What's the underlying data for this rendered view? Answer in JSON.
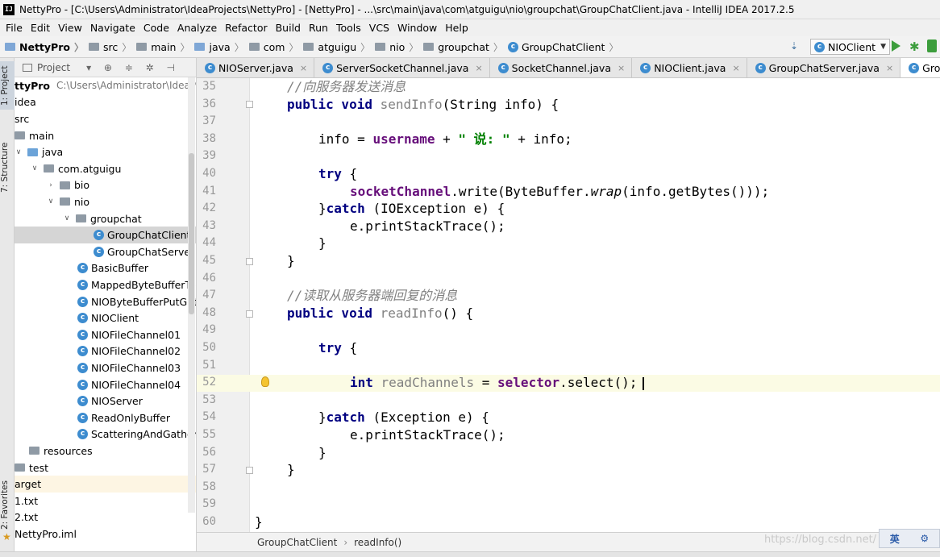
{
  "window": {
    "title": "NettyPro - [C:\\Users\\Administrator\\IdeaProjects\\NettyPro] - [NettyPro] - ...\\src\\main\\java\\com\\atguigu\\nio\\groupchat\\GroupChatClient.java - IntelliJ IDEA 2017.2.5",
    "app_icon": "IJ"
  },
  "menu": [
    "File",
    "Edit",
    "View",
    "Navigate",
    "Code",
    "Analyze",
    "Refactor",
    "Build",
    "Run",
    "Tools",
    "VCS",
    "Window",
    "Help"
  ],
  "navbar": {
    "crumbs": [
      "NettyPro",
      "src",
      "main",
      "java",
      "com",
      "atguigu",
      "nio",
      "groupchat",
      "GroupChatClient"
    ],
    "run_config": "NIOClient"
  },
  "sidebar_tabs": {
    "project": "1: Project",
    "structure": "7: Structure",
    "favorites": "2: Favorites"
  },
  "project_panel": {
    "title": "Project",
    "tree": [
      {
        "label": "ttyPro",
        "path": "C:\\Users\\Administrator\\IdeaProje"
      },
      {
        "label": "idea"
      },
      {
        "label": "src"
      },
      {
        "label": "main"
      },
      {
        "label": "java"
      },
      {
        "label": "com.atguigu"
      },
      {
        "label": "bio"
      },
      {
        "label": "nio"
      },
      {
        "label": "groupchat"
      },
      {
        "label": "GroupChatClient"
      },
      {
        "label": "GroupChatServer"
      },
      {
        "label": "BasicBuffer"
      },
      {
        "label": "MappedByteBufferTest"
      },
      {
        "label": "NIOByteBufferPutGet"
      },
      {
        "label": "NIOClient"
      },
      {
        "label": "NIOFileChannel01"
      },
      {
        "label": "NIOFileChannel02"
      },
      {
        "label": "NIOFileChannel03"
      },
      {
        "label": "NIOFileChannel04"
      },
      {
        "label": "NIOServer"
      },
      {
        "label": "ReadOnlyBuffer"
      },
      {
        "label": "ScatteringAndGathering"
      },
      {
        "label": "resources"
      },
      {
        "label": "test"
      },
      {
        "label": "arget"
      },
      {
        "label": "1.txt"
      },
      {
        "label": "2.txt"
      },
      {
        "label": "NettyPro.iml"
      }
    ]
  },
  "editor": {
    "tabs": [
      "NIOServer.java",
      "ServerSocketChannel.java",
      "SocketChannel.java",
      "NIOClient.java",
      "GroupChatServer.java",
      "GroupChatClient.ja"
    ],
    "line_numbers": [
      "35",
      "36",
      "37",
      "38",
      "39",
      "40",
      "41",
      "42",
      "43",
      "44",
      "45",
      "46",
      "47",
      "48",
      "49",
      "50",
      "51",
      "52",
      "53",
      "54",
      "55",
      "56",
      "57",
      "58",
      "59",
      "60"
    ],
    "code": {
      "l35_comment": "//向服务器发送消息",
      "l36_kw": "public void ",
      "l36_method": "sendInfo",
      "l36_rest": "(String info) {",
      "l38_a": "info = ",
      "l38_field": "username",
      "l38_b": " + ",
      "l38_str": "\" 说: \"",
      "l38_c": " + info;",
      "l40_kw": "try",
      "l40_rest": " {",
      "l41_field": "socketChannel",
      "l41_a": ".write(ByteBuffer.",
      "l41_italic": "wrap",
      "l41_b": "(info.getBytes()));",
      "l42_a": "}",
      "l42_kw": "catch",
      "l42_b": " (IOException e) {",
      "l43": "e.printStackTrace();",
      "l44": "}",
      "l45": "}",
      "l47_comment": "//读取从服务器端回复的消息",
      "l48_kw": "public void ",
      "l48_method": "readInfo",
      "l48_rest": "() {",
      "l50_kw": "try",
      "l50_rest": " {",
      "l52_kw": "int ",
      "l52_var": "readChannels",
      "l52_a": " = ",
      "l52_field": "selector",
      "l52_b": ".select();",
      "l54_a": "}",
      "l54_kw": "catch",
      "l54_b": " (Exception e) {",
      "l55": "e.printStackTrace();",
      "l56": "}",
      "l57": "}",
      "l60": "}"
    },
    "breadcrumb": [
      "GroupChatClient",
      "readInfo()"
    ]
  },
  "watermark": "https://blog.csdn.net/",
  "ime": {
    "mode": "英",
    "extra": "⚙"
  },
  "colors": {
    "keyword": "#000080",
    "comment": "#808080",
    "field": "#660e7a",
    "string": "#008000",
    "caret_row": "#fbfbe4",
    "class_icon": "#3d8ccf",
    "run": "#3c9d3c"
  }
}
